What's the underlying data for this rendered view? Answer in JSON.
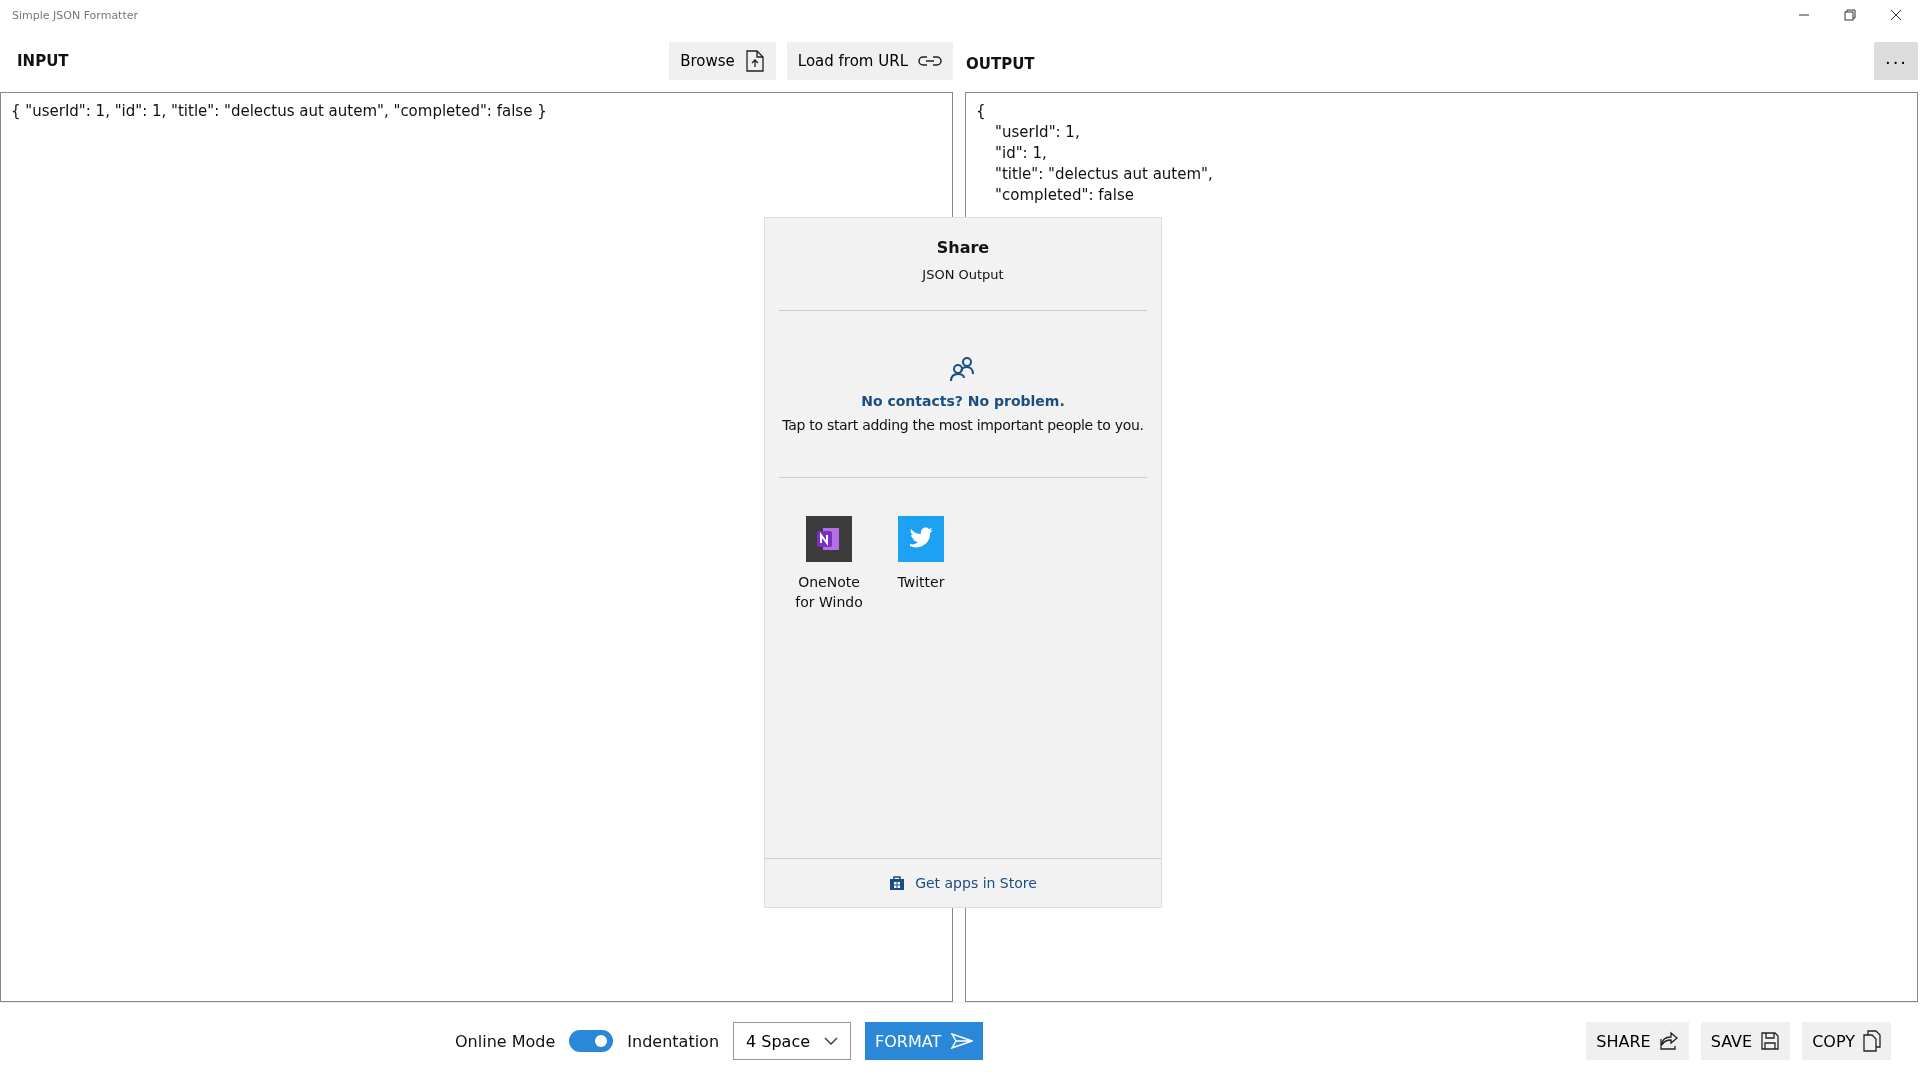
{
  "window": {
    "title": "Simple JSON Formatter"
  },
  "input": {
    "heading": "INPUT",
    "buttons": [
      "Browse",
      "Load from URL"
    ],
    "text": "{ \"userId\": 1, \"id\": 1, \"title\": \"delectus aut autem\", \"completed\": false }"
  },
  "output": {
    "heading": "OUTPUT",
    "more": "···",
    "lines": [
      "{",
      "    \"userId\": 1,",
      "    \"id\": 1,",
      "    \"title\": \"delectus aut autem\",",
      "    \"completed\": false"
    ]
  },
  "share": {
    "title": "Share",
    "subtitle": "JSON Output",
    "contacts_title": "No contacts? No problem.",
    "contacts_text": "Tap to start adding the most important people to you.",
    "apps": [
      {
        "kind": "onenote",
        "label": "OneNote for Windo"
      },
      {
        "kind": "twitter",
        "label": "Twitter"
      }
    ],
    "store_link": "Get apps in Store"
  },
  "bottom": {
    "online_mode": {
      "label": "Online Mode",
      "on": true
    },
    "indentation": {
      "label": "Indentation",
      "value": "4 Space"
    },
    "format": "FORMAT",
    "actions": [
      "SHARE",
      "SAVE",
      "COPY"
    ]
  }
}
